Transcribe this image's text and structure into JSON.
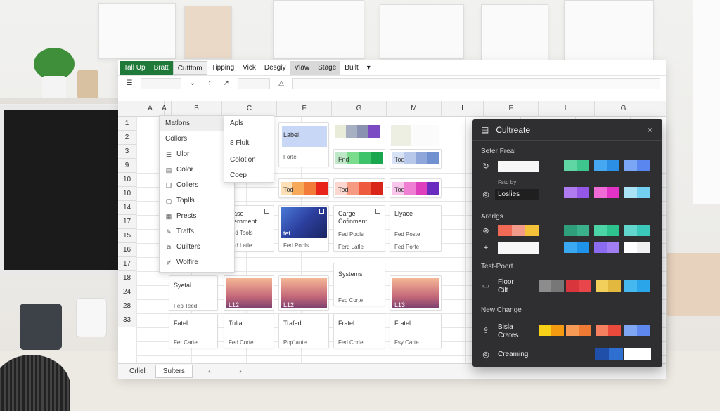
{
  "ribbon": {
    "tabs": [
      {
        "label": "Tall Up"
      },
      {
        "label": "Bratt"
      },
      {
        "label": "Cutttom"
      },
      {
        "label": "Tipping"
      },
      {
        "label": "Vick"
      },
      {
        "label": "Desgiy"
      },
      {
        "label": "Vlaw"
      },
      {
        "label": "Stage"
      },
      {
        "label": "Bullt"
      }
    ],
    "dropdown_icon": "chevron-down-icon"
  },
  "columns": [
    "A",
    "A",
    "B",
    "C",
    "F",
    "G",
    "M",
    "I",
    "F",
    "L",
    "G"
  ],
  "rows": [
    "1",
    "2",
    "3",
    "9",
    "10",
    "10",
    "14",
    "17",
    "15",
    "16",
    "17",
    "18",
    "24",
    "28",
    "33"
  ],
  "menu_left": {
    "items": [
      {
        "label": "Matlons",
        "icon": ""
      },
      {
        "label": "Collors",
        "icon": ""
      },
      {
        "label": "Ulor",
        "icon": "list-icon"
      },
      {
        "label": "Color",
        "icon": "palette-icon"
      },
      {
        "label": "Collers",
        "icon": "copy-icon"
      },
      {
        "label": "Toplls",
        "icon": "toolbox-icon"
      },
      {
        "label": "Prests",
        "icon": "preset-icon"
      },
      {
        "label": "Traffs",
        "icon": "brush-icon"
      },
      {
        "label": "Cuilters",
        "icon": "filter-icon"
      },
      {
        "label": "Wolfire",
        "icon": "edit-icon"
      }
    ]
  },
  "menu_right": {
    "items": [
      {
        "label": "Apls"
      },
      {
        "label": "8 Flult"
      },
      {
        "label": "Colotlon"
      },
      {
        "label": "Coep"
      }
    ]
  },
  "cards": {
    "label_card": {
      "title": "Label",
      "sub": "Forte",
      "color": "#c8d7f5"
    },
    "greens_card": {
      "label": "Fnd"
    },
    "blues_card": {
      "label": "Tod"
    },
    "orange_card": {
      "label": "Tod"
    },
    "red_card": {
      "label": "Tod"
    },
    "pink_card": {
      "label": "Tod"
    },
    "cmp1": {
      "line1": "Gase",
      "line2": "Gernment",
      "line3": "Fed Tools",
      "line4": "Fed Latle"
    },
    "cmp2": {
      "line1": "tet",
      "line3": "Fed Pools",
      "line4": "Fed Porte"
    },
    "cmp3": {
      "line1": "Carge",
      "line2": "Cofinment",
      "line3": "Fed Pools",
      "line4": "Ferd Latle"
    },
    "cmp4": {
      "line1": "Llyace",
      "line3": "Fed Poste",
      "line4": "Fed Porte"
    },
    "systems": {
      "line1": "Systems",
      "line2": "Fsp Corte"
    },
    "syetal": {
      "line1": "Syetal",
      "line2": "Fep Teed"
    },
    "img1": {
      "line1": "L12"
    },
    "img2": {
      "line1": "L12"
    },
    "img3": {
      "line1": "L13"
    },
    "row_bottom": [
      {
        "line1": "Fatel",
        "line2": "Fer Carte"
      },
      {
        "line1": "Tultal",
        "line2": "Fed Corte"
      },
      {
        "line1": "Trafed",
        "line2": "Pop'lante"
      },
      {
        "line1": "Fratel",
        "line2": "Fed Corte"
      },
      {
        "line1": "Fratel",
        "line2": "Fsy Carte"
      }
    ]
  },
  "sheet_tabs": {
    "tabs": [
      {
        "label": "Crliel"
      },
      {
        "label": "Sulters"
      }
    ],
    "prev_icon": "chevron-left-icon",
    "next_icon": "chevron-right-icon"
  },
  "panel": {
    "title": "Cultreate",
    "close_label": "×",
    "sections": [
      {
        "label": "Seter Freal"
      },
      {
        "label": "Arerlgs"
      },
      {
        "label": "Test-Poort"
      },
      {
        "label": "New Change"
      }
    ],
    "sub_label": "Fstd by",
    "input_value": "Loslies",
    "row_floor": "Floor Cilt",
    "row_bisla": "Bisla Crates",
    "row_creaming": "Creaming"
  }
}
